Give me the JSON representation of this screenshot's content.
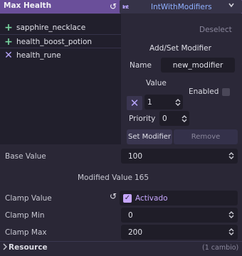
{
  "header": {
    "title": "Max Health",
    "revert_icon": "revert-icon",
    "type_icon_text": "Int",
    "type_label": "IntWithModifiers",
    "accent": "#6a4f9a"
  },
  "modifier_list": {
    "items": [
      {
        "label": "sapphire_necklace",
        "icon": "plus-icon"
      },
      {
        "label": "health_boost_potion",
        "icon": "plus-icon"
      },
      {
        "label": "health_rune",
        "icon": "multiply-icon"
      }
    ]
  },
  "editor": {
    "deselect_label": "Deselect",
    "section_title": "Add/Set Modifier",
    "name_label": "Name",
    "name_value": "new_modifier",
    "value_label": "Value",
    "enabled_label": "Enabled",
    "operator_icon": "multiply-icon",
    "value_value": "1",
    "priority_label": "Priority",
    "priority_value": "0",
    "set_button": "Set Modifier",
    "remove_button": "Remove"
  },
  "properties": {
    "base_value_label": "Base Value",
    "base_value": "100",
    "modified_label": "Modified Value",
    "modified_value": "165",
    "clamp_value_label": "Clamp Value",
    "clamp_value_text": "Activado",
    "clamp_min_label": "Clamp Min",
    "clamp_min": "0",
    "clamp_max_label": "Clamp Max",
    "clamp_max": "200"
  },
  "footer": {
    "resource_label": "Resource",
    "changes_text": "(1 cambio)"
  }
}
